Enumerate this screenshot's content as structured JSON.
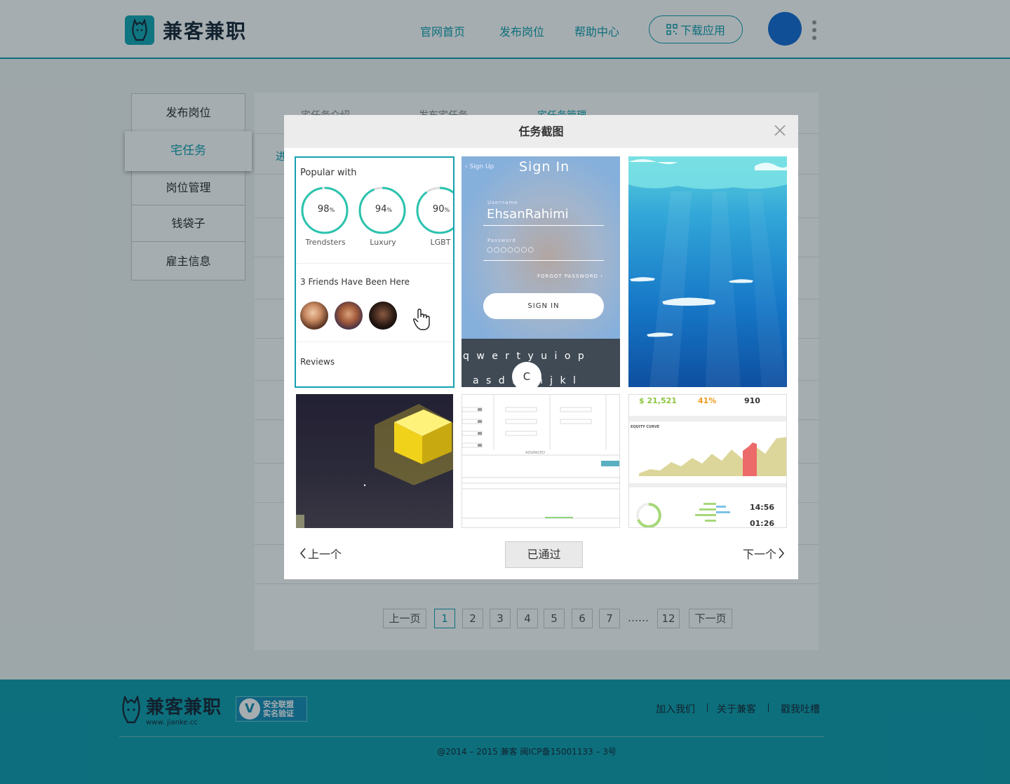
{
  "header": {
    "brand": "兼客兼职",
    "nav": [
      "官网首页",
      "发布岗位",
      "帮助中心"
    ],
    "download_label": "下载应用",
    "accent": "#14a0b0"
  },
  "side_menu": {
    "items": [
      "发布岗位",
      "宅任务",
      "岗位管理",
      "钱袋子",
      "雇主信息"
    ],
    "active_index": 1
  },
  "panel": {
    "tabs": [
      "宅任务介绍",
      "发布宅任务",
      "宅任务管理"
    ],
    "active_tab": 2,
    "partial_text": "进"
  },
  "pagination": {
    "prev_label": "上一页",
    "pages": [
      "1",
      "2",
      "3",
      "4",
      "5",
      "6",
      "7"
    ],
    "ellipsis": "……",
    "last_page": "12",
    "next_label": "下一页",
    "current_page": "1"
  },
  "modal": {
    "title": "任务截图",
    "prev_label": "上一个",
    "next_label": "下一个",
    "status_label": "已通过",
    "selected_thumb": 0,
    "thumbs": [
      {
        "heading": "Popular with",
        "rings": [
          {
            "value": "98",
            "unit": "%",
            "label": "Trendsters",
            "level": 0.98
          },
          {
            "value": "94",
            "unit": "%",
            "label": "Luxury",
            "level": 0.94
          },
          {
            "value": "90",
            "unit": "%",
            "label": "LGBT",
            "level": 0.9
          }
        ],
        "friends": "3 Friends Have Been Here",
        "reviews": "Reviews"
      },
      {
        "back": "‹ Sign Up",
        "title": "Sign In",
        "username_label": "Username",
        "username": "EhsanRahimi",
        "password_label": "Password",
        "password": "○○○○○○○",
        "forgot": "FORGOT PASSWORD ›",
        "button": "SIGN IN",
        "keys_row1": "q w e r t y u i o p",
        "keys_row2": "a s d f g h j k l",
        "key_popup": "C"
      },
      {
        "scene": "whales-underwater"
      },
      {
        "scene": "glowing-cube"
      },
      {
        "scene": "form-wireframe",
        "advanced": "ADVANCED"
      },
      {
        "stat1": "$ 21,521",
        "stat2": "41%",
        "stat3": "910",
        "curve_label": "EQUITY CURVE",
        "time1": "14:56",
        "time2": "01:26"
      }
    ]
  },
  "footer": {
    "brand": "兼客兼职",
    "domain": "www. jianke.cc",
    "badge_line1": "安全联盟",
    "badge_line2": "实名验证",
    "links": [
      "加入我们",
      "关于兼客",
      "戳我吐槽"
    ],
    "copyright": "@2014 – 2015  兼客  闽ICP备15001133 – 3号"
  }
}
